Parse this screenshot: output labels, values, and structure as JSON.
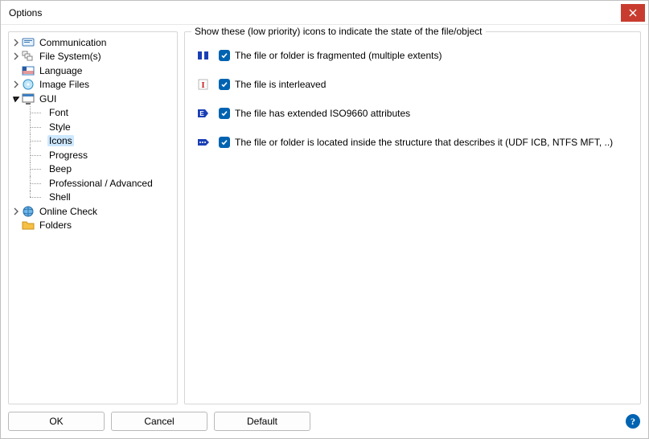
{
  "window": {
    "title": "Options"
  },
  "tree": {
    "items": [
      {
        "label": "Communication"
      },
      {
        "label": "File System(s)"
      },
      {
        "label": "Language"
      },
      {
        "label": "Image Files"
      },
      {
        "label": "GUI"
      },
      {
        "label": "Online Check"
      },
      {
        "label": "Folders"
      }
    ],
    "gui_children": [
      {
        "label": "Font"
      },
      {
        "label": "Style"
      },
      {
        "label": "Icons"
      },
      {
        "label": "Progress"
      },
      {
        "label": "Beep"
      },
      {
        "label": "Professional / Advanced"
      },
      {
        "label": "Shell"
      }
    ]
  },
  "panel": {
    "group_title": "Show these (low priority) icons to indicate the state of the file/object",
    "options": [
      {
        "label": "The file or folder is fragmented (multiple extents)"
      },
      {
        "label": "The file is interleaved"
      },
      {
        "label": "The file has extended ISO9660 attributes"
      },
      {
        "label": "The file or folder is located inside the structure that describes it (UDF ICB, NTFS MFT, ..)"
      }
    ]
  },
  "buttons": {
    "ok": "OK",
    "cancel": "Cancel",
    "default": "Default"
  }
}
